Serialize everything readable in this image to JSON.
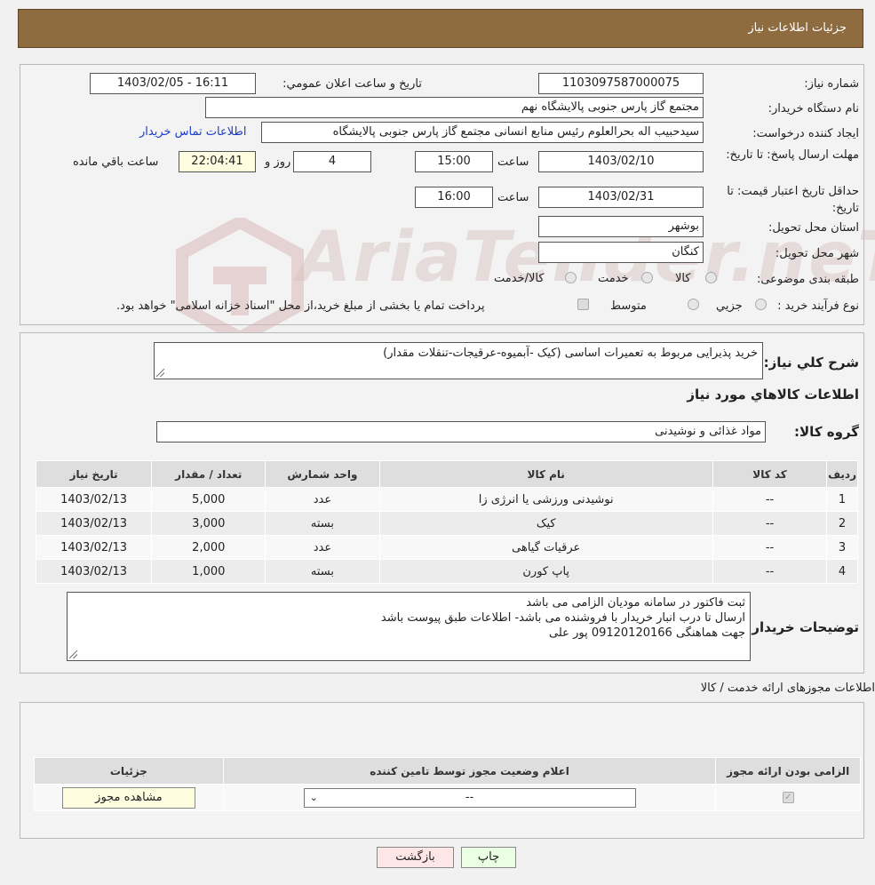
{
  "header": {
    "title": "جزئیات اطلاعات نیاز"
  },
  "info": {
    "need_number_label": "شماره نیاز:",
    "need_number": "1103097587000075",
    "announce_label": "تاریخ و ساعت اعلان عمومي:",
    "announce_value": "1403/02/05 - 16:11",
    "buyer_org_label": "نام دستگاه خريدار:",
    "buyer_org": "مجتمع گاز پارس جنوبی  پالایشگاه نهم",
    "creator_label": "ايجاد کننده درخواست:",
    "creator": "سیدحبیب اله بحرالعلوم رئیس منابع انسانی مجتمع گاز پارس جنوبی  پالایشگاه",
    "contact_link": "اطلاعات تماس خريدار",
    "deadline_label": "مهلت ارسال پاسخ: تا تاریخ:",
    "deadline_date": "1403/02/10",
    "time_label": "ساعت",
    "deadline_time": "15:00",
    "remaining_days": "4",
    "day_and_label": "روز و",
    "remaining_time": "22:04:41",
    "remaining_label": "ساعت باقي مانده",
    "validity_label": "حداقل تاریخ اعتبار قیمت: تا تاریخ:",
    "validity_date": "1403/02/31",
    "validity_time": "16:00",
    "province_label": "استان محل تحويل:",
    "province": "بوشهر",
    "city_label": "شهر محل تحويل:",
    "city": "کنگان",
    "category_label": "طبقه بندی موضوعی:",
    "category_options": [
      "کالا",
      "خدمت",
      "کالا/خدمت"
    ],
    "purchase_type_label": "نوع فرآيند خريد :",
    "purchase_options": [
      "جزيي",
      "متوسط"
    ],
    "payment_note": "پرداخت تمام یا بخشی از مبلغ خرید،از محل \"اسناد خزانه اسلامی\" خواهد بود."
  },
  "watermark": {
    "text": "AriaTender.neT"
  },
  "details": {
    "description_label": "شرح کلي نياز:",
    "description": "خرید پذیرایی مربوط به تعمیرات اساسی (کیک -آبمیوه-عرقیجات-تنقلات مقدار)",
    "goods_info_title": "اطلاعات کالاهاي مورد نياز",
    "group_label": "گروه کالا:",
    "group_value": "مواد غذائی و نوشیدنی",
    "table": {
      "headers": [
        "رديف",
        "کد کالا",
        "نام کالا",
        "واحد شمارش",
        "تعداد / مقدار",
        "تاریخ نیاز"
      ],
      "rows": [
        [
          "1",
          "--",
          "نوشیدنی ورزشی یا انرژی زا",
          "عدد",
          "5,000",
          "1403/02/13"
        ],
        [
          "2",
          "--",
          "کیک",
          "بسته",
          "3,000",
          "1403/02/13"
        ],
        [
          "3",
          "--",
          "عرقیات گیاهی",
          "عدد",
          "2,000",
          "1403/02/13"
        ],
        [
          "4",
          "--",
          "پاپ کورن",
          "بسته",
          "1,000",
          "1403/02/13"
        ]
      ]
    },
    "buyer_notes_label": "توضيحات خريدار:",
    "buyer_notes": [
      "ثبت فاکتور در سامانه مودیان الزامی می باشد",
      "ارسال تا درب انبار خریدار با فروشنده می باشد- اطلاعات طبق پیوست باشد",
      "جهت هماهنگی  09120120166 پور علی"
    ]
  },
  "licenses": {
    "title": "اطلاعات مجوزهای ارائه خدمت / کالا",
    "headers": [
      "الزامی بودن ارائه مجوز",
      "اعلام وضعيت مجوز توسط تامين کننده",
      "جزئيات"
    ],
    "select_value": "--",
    "view_button": "مشاهده مجوز"
  },
  "buttons": {
    "print": "چاپ",
    "back": "بازگشت"
  }
}
